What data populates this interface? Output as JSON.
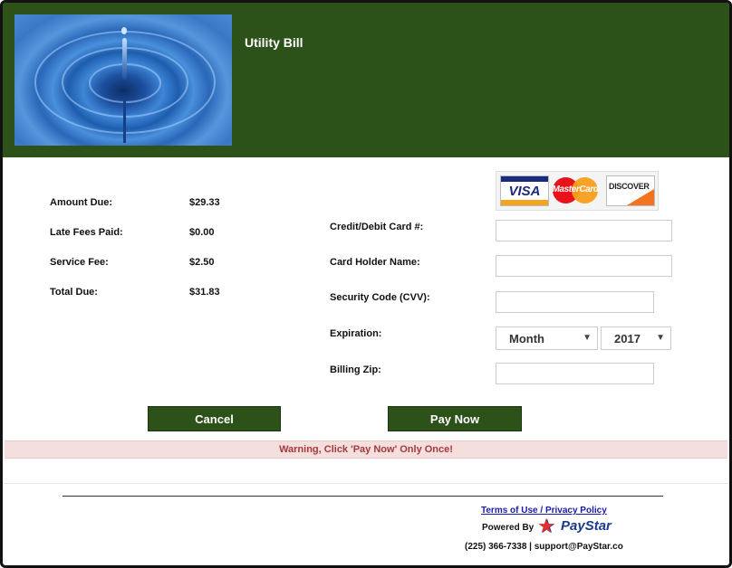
{
  "header": {
    "title": "Utility Bill",
    "image_icon": "water-drop-ripple"
  },
  "summary": {
    "rows": [
      {
        "label": "Amount Due:",
        "value": "$29.33"
      },
      {
        "label": "Late Fees Paid:",
        "value": "$0.00"
      },
      {
        "label": "Service Fee:",
        "value": "$2.50"
      },
      {
        "label": "Total Due:",
        "value": "$31.83"
      }
    ]
  },
  "cards": {
    "visa": "VISA",
    "mastercard": "MasterCard",
    "discover": "DISCOVER"
  },
  "form": {
    "card_number_label": "Credit/Debit Card #:",
    "card_number_value": "",
    "holder_label": "Card Holder Name:",
    "holder_value": "",
    "cvv_label": "Security Code (CVV):",
    "cvv_value": "",
    "expiration_label": "Expiration:",
    "month_selected": "Month",
    "year_selected": "2017",
    "zip_label": "Billing Zip:",
    "zip_value": ""
  },
  "actions": {
    "cancel_label": "Cancel",
    "pay_label": "Pay Now"
  },
  "warning": "Warning, Click 'Pay Now' Only Once!",
  "footer": {
    "terms_label": "Terms of Use / Privacy Policy",
    "powered_by": "Powered By",
    "brand": "PayStar",
    "contact": "(225) 366-7338 | support@PayStar.co"
  },
  "colors": {
    "header_green": "#2c5119",
    "warning_bg": "#f5dede",
    "warning_text": "#a33a3a",
    "link_blue": "#1a1aaa"
  }
}
